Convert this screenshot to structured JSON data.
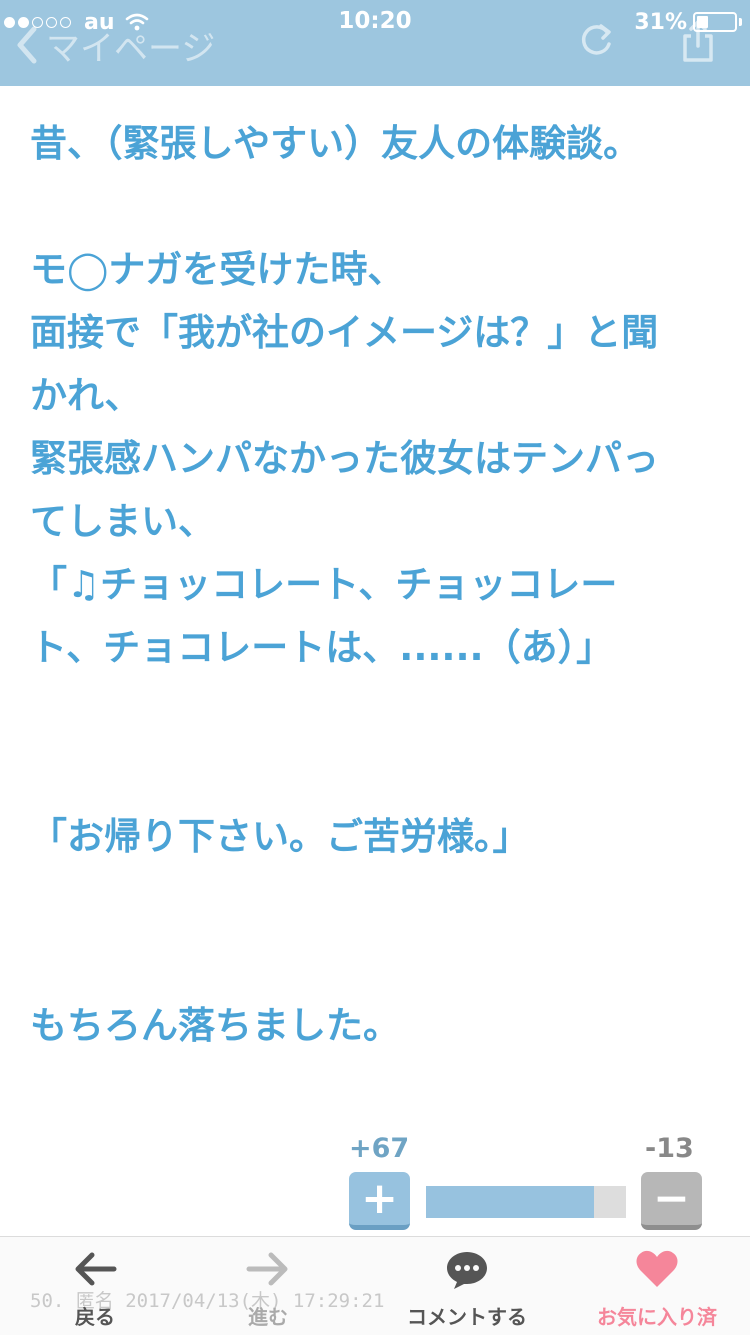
{
  "status_bar": {
    "carrier": "au",
    "time": "10:20",
    "battery_percent": "31%",
    "battery_level": 0.31,
    "signal_bars_filled": 2,
    "signal_bars_total": 5
  },
  "nav": {
    "back_label": "マイページ",
    "icons": [
      "chevron-left-icon",
      "reload-icon",
      "share-icon"
    ]
  },
  "article": {
    "lines": [
      "昔、（緊張しやすい）友人の体験談。",
      "",
      "モ◯ナガを受けた時、",
      "面接で「我が社のイメージは？」と聞",
      "かれ、",
      "緊張感ハンパなかった彼女はテンパっ",
      "てしまい、",
      "「♫チョッコレート、チョッコレー",
      "ト、チョコレートは、......（あ）」",
      "",
      "",
      "「お帰り下さい。ご苦労様。」",
      "",
      "",
      "もちろん落ちました。"
    ]
  },
  "vote": {
    "plus_count": "+67",
    "minus_count": "-13",
    "plus_label": "+",
    "minus_label": "−",
    "positive_ratio": 0.84
  },
  "meta": {
    "post_info": "50. 匿名 2017/04/13(木) 17:29:21"
  },
  "toolbar": {
    "back_label": "戻る",
    "forward_label": "進む",
    "comment_label": "コメントする",
    "favorite_label": "お気に入り済"
  },
  "colors": {
    "header_bg": "#9dc6df",
    "article_text": "#4ba3d6",
    "favorite": "#f5869a"
  }
}
